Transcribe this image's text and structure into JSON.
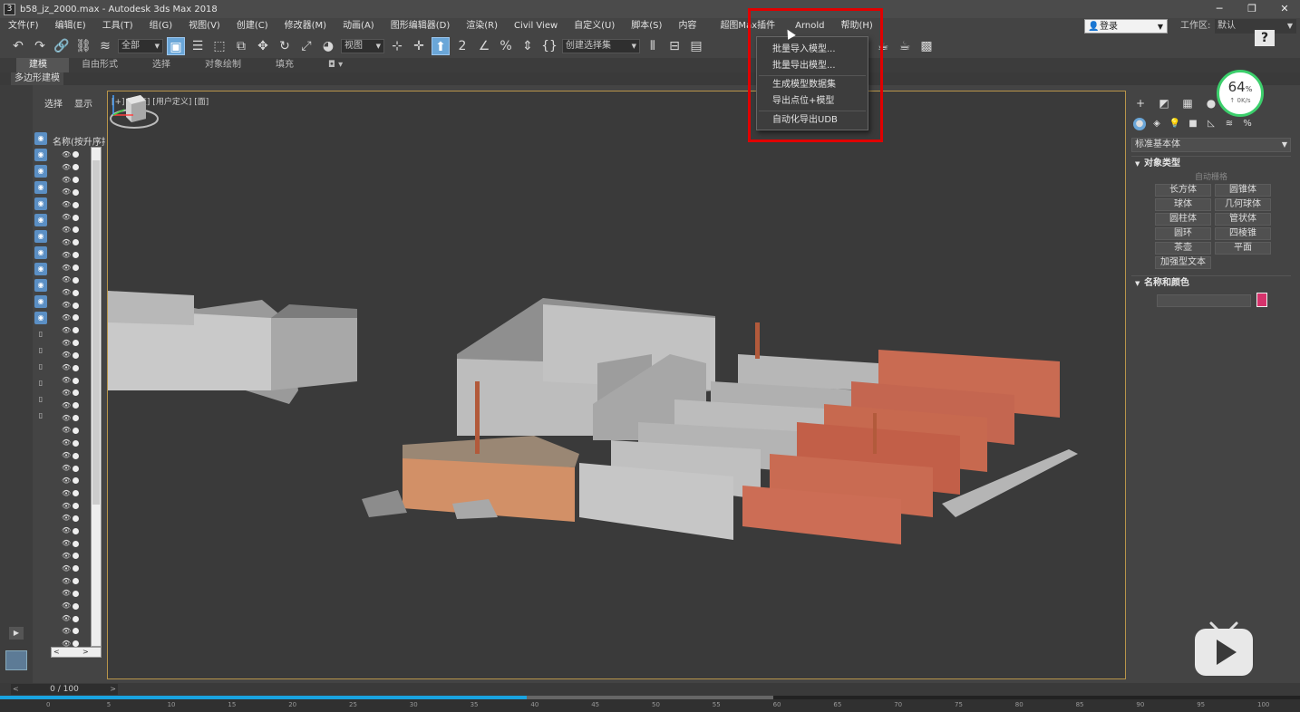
{
  "window": {
    "title": "b58_jz_2000.max - Autodesk 3ds Max 2018",
    "app_icon": "3",
    "buttons": [
      "─",
      "❐",
      "✕"
    ]
  },
  "menubar": {
    "items": [
      "文件(F)",
      "编辑(E)",
      "工具(T)",
      "组(G)",
      "视图(V)",
      "创建(C)",
      "修改器(M)",
      "动画(A)",
      "图形编辑器(D)",
      "渲染(R)",
      "Civil View",
      "自定义(U)",
      "脚本(S)",
      "内容",
      "超图Max插件",
      "Arnold",
      "帮助(H)"
    ],
    "login_label": "登录",
    "workspace_label": "工作区:",
    "workspace_value": "默认"
  },
  "plugin_menu": {
    "items": [
      "批量导入模型...",
      "批量导出模型...",
      "生成模型数据集",
      "导出点位+模型",
      "自动化导出UDB"
    ]
  },
  "toolbar": {
    "selection_filter": "全部",
    "view_dropdown": "视图",
    "named_selection": "创建选择集",
    "help": "?"
  },
  "ribbon": {
    "tabs": [
      "建模",
      "自由形式",
      "选择",
      "对象绘制",
      "填充"
    ],
    "subpanel": "多边形建模"
  },
  "explorer": {
    "tabs": [
      "选择",
      "显示"
    ],
    "column_header": "名称(按升序排序)",
    "row_count": 40
  },
  "viewport": {
    "label": "[+] [正交] [用户定义] [面]"
  },
  "command_panel": {
    "category": "标准基本体",
    "rollout_object_type": "对象类型",
    "auto_grid": "自动栅格",
    "object_buttons": [
      "长方体",
      "圆锥体",
      "球体",
      "几何球体",
      "圆柱体",
      "管状体",
      "圆环",
      "四棱锥",
      "茶壶",
      "平面",
      "加强型文本"
    ],
    "rollout_name_color": "名称和颜色",
    "color": "#d6336c"
  },
  "net_widget": {
    "percent": "64",
    "unit": "%",
    "speed": "↑ 0K/s"
  },
  "timeline": {
    "frame": "0 / 100",
    "progress_fraction": 0.405,
    "ticks": [
      "0",
      "5",
      "10",
      "15",
      "20",
      "25",
      "30",
      "35",
      "40",
      "45",
      "50",
      "55",
      "60",
      "65",
      "70",
      "75",
      "80",
      "85",
      "90",
      "95",
      "100"
    ]
  },
  "colors": {
    "highlight": "#e00000",
    "accent": "#6aa6d8",
    "viewport_border": "#b8954a"
  }
}
